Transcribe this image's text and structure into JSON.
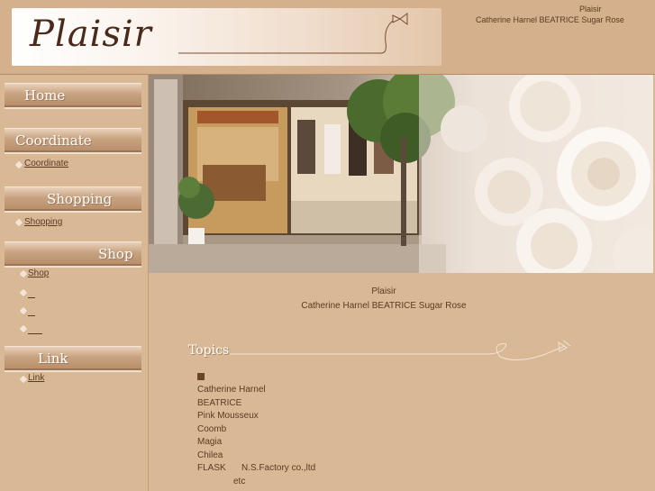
{
  "header": {
    "logo": "Plaisir",
    "brand": "Plaisir",
    "tagline": "Catherine Harnel BEATRICE Sugar Rose"
  },
  "sidebar": {
    "home": "Home",
    "coordinate_title": "Coordinate",
    "coordinate_link": "Coordinate",
    "shopping_title": "Shopping",
    "shopping_link": "Shopping",
    "shop_title": "Shop",
    "shop_links": [
      "Shop",
      "",
      "",
      ""
    ],
    "link_title": "Link",
    "link_link": "Link"
  },
  "main": {
    "store_name": "Plaisir",
    "store_brands": "Catherine Harnel BEATRICE Sugar Rose",
    "topics_title": "Topics",
    "topics_marker": "■",
    "topics": [
      "Catherine Harnel",
      "BEATRICE",
      "Pink Mousseux",
      "Coomb",
      "Magia",
      "Chilea",
      "FLASK",
      "N.S.Factory co.,ltd",
      "etc"
    ]
  },
  "colors": {
    "background": "#d9b896",
    "text": "#5a3b22",
    "accent": "#6b4326"
  }
}
